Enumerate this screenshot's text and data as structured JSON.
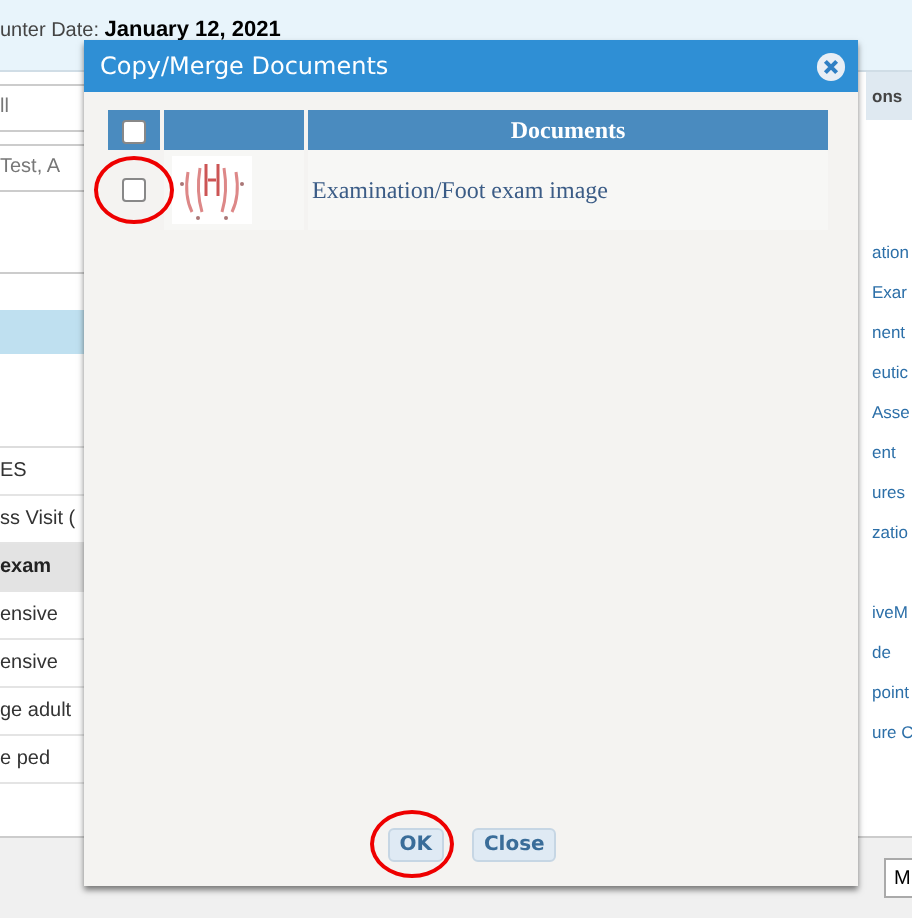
{
  "background": {
    "encounter_label": "unter Date:",
    "encounter_date": "January 12, 2021",
    "left_fields": [
      "ll",
      "Test, A"
    ],
    "left_items": [
      {
        "label": "ES",
        "selected": false
      },
      {
        "label": "ss Visit (",
        "selected": false
      },
      {
        "label": "exam",
        "selected": true
      },
      {
        "label": "ensive",
        "selected": false
      },
      {
        "label": "ensive",
        "selected": false
      },
      {
        "label": "ge adult",
        "selected": false
      },
      {
        "label": "e ped",
        "selected": false
      }
    ],
    "right_header": "ons",
    "right_items_top": [
      "ation",
      "Exar",
      "nent",
      "eutic",
      "Asse",
      "ent",
      "ures",
      "zatio"
    ],
    "right_items_bottom": [
      "iveM",
      "de",
      "point",
      "ure C"
    ],
    "right_button": "M"
  },
  "dialog": {
    "title": "Copy/Merge Documents",
    "table": {
      "select_all_checked": false,
      "column_header": "Documents",
      "rows": [
        {
          "checked": false,
          "circled": true,
          "document": "Examination/Foot exam image"
        }
      ]
    },
    "buttons": [
      {
        "label": "OK",
        "circled": true
      },
      {
        "label": "Close",
        "circled": false
      }
    ]
  }
}
